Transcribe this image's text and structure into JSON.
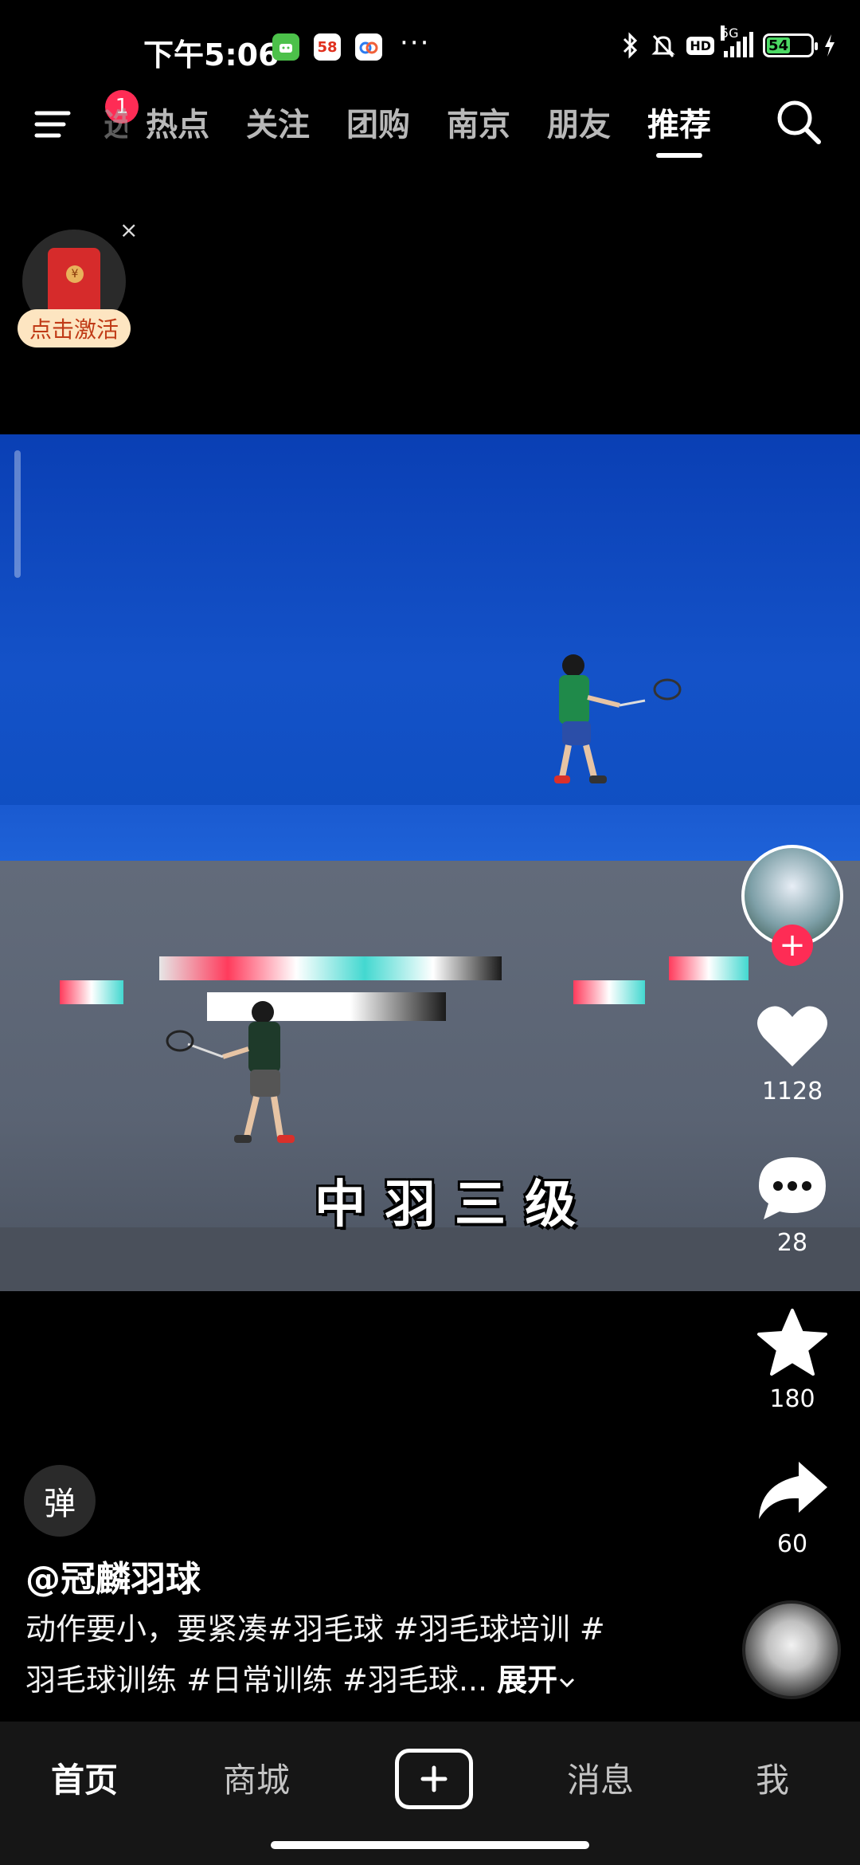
{
  "status_bar": {
    "time": "下午5:06",
    "app_chip_58": "58",
    "network": "5G",
    "hd_label": "HD",
    "battery_level": "54"
  },
  "top_nav": {
    "notification_count": "1",
    "partial_tab": "选",
    "tabs": [
      "热点",
      "关注",
      "团购",
      "南京",
      "朋友",
      "推荐"
    ],
    "active_tab": "推荐"
  },
  "red_packet": {
    "label": "点击激活",
    "close": "×"
  },
  "video": {
    "overlay_caption": "中羽三级"
  },
  "actions": {
    "likes": "1128",
    "comments": "28",
    "favorites": "180",
    "shares": "60"
  },
  "post": {
    "danmu_button": "弹",
    "author": "@冠麟羽球",
    "desc_line1": "动作要小，要紧凑#羽毛球 #羽毛球培训 #",
    "desc_line2": "羽毛球训练 #日常训练 #羽毛球...",
    "expand_label": "展开"
  },
  "bottom_nav": {
    "home": "首页",
    "mall": "商城",
    "messages": "消息",
    "me": "我"
  },
  "colors": {
    "accent": "#fe2c55",
    "battery": "#4cd964"
  }
}
